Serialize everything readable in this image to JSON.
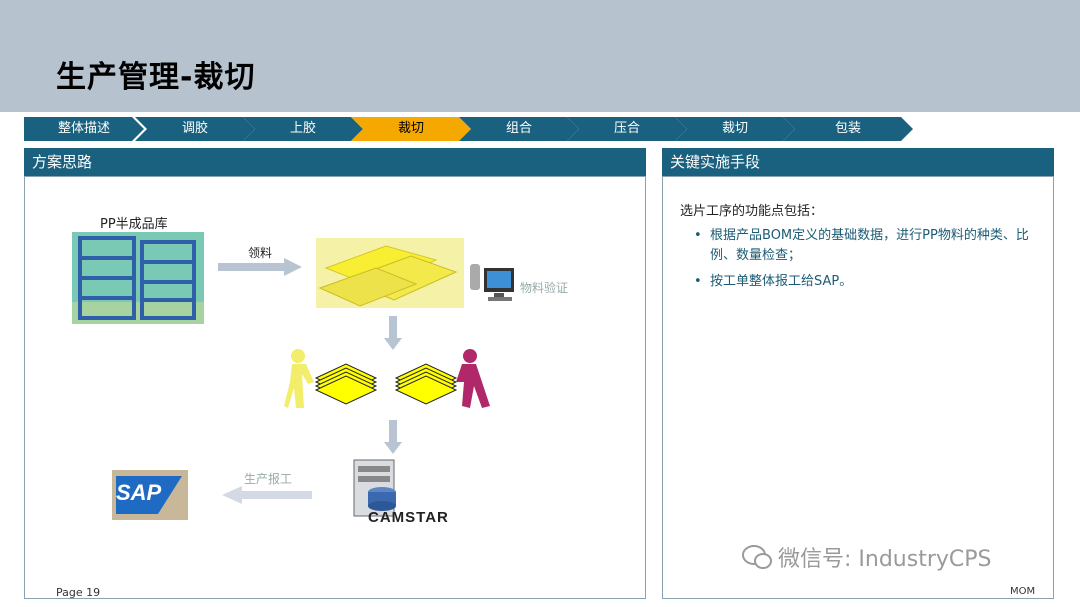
{
  "title": "生产管理-裁切",
  "steps": [
    {
      "label": "整体描述",
      "active": false
    },
    {
      "label": "调胶",
      "active": false
    },
    {
      "label": "上胶",
      "active": false
    },
    {
      "label": "裁切",
      "active": true
    },
    {
      "label": "组合",
      "active": false
    },
    {
      "label": "压合",
      "active": false
    },
    {
      "label": "裁切",
      "active": false
    },
    {
      "label": "包装",
      "active": false
    }
  ],
  "left_panel": {
    "header": "方案思路",
    "warehouse_label": "PP半成品库",
    "arrow_collect": "领料",
    "material_verify": "物料验证",
    "production_report": "生产报工",
    "sap_logo": "SAP",
    "camstar_logo": "CAMSTAR"
  },
  "right_panel": {
    "header": "关键实施手段",
    "intro": "选片工序的功能点包括：",
    "bullets": [
      "根据产品BOM定义的基础数据，进行PP物料的种类、比例、数量检查；",
      "按工单整体报工给SAP。"
    ]
  },
  "footer": {
    "page": "Page 19",
    "tag": "MOM"
  },
  "watermark": "微信号: IndustryCPS",
  "colors": {
    "header_band": "#b6c3cf",
    "step_fill": "#19617f",
    "step_active": "#f5a800",
    "panel_header": "#19617f"
  }
}
